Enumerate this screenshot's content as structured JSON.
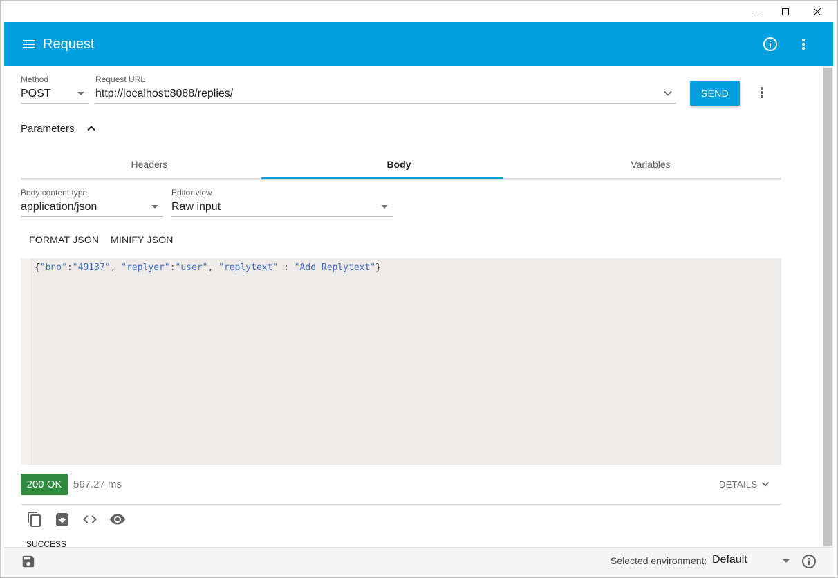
{
  "window": {
    "controls": {
      "minimize": "minimize-icon",
      "maximize": "maximize-icon",
      "close": "close-icon"
    }
  },
  "appbar": {
    "title": "Request",
    "color": "#03a0e0",
    "icons": {
      "menu": "menu-icon",
      "info": "info-icon",
      "more": "more-vert-icon"
    }
  },
  "request": {
    "method_label": "Method",
    "method_value": "POST",
    "url_label": "Request URL",
    "url_value": "http://localhost:8088/replies/",
    "send_label": "SEND"
  },
  "parameters": {
    "label": "Parameters",
    "tabs": [
      {
        "label": "Headers",
        "active": false
      },
      {
        "label": "Body",
        "active": true
      },
      {
        "label": "Variables",
        "active": false
      }
    ]
  },
  "body": {
    "content_type_label": "Body content type",
    "content_type_value": "application/json",
    "editor_view_label": "Editor view",
    "editor_view_value": "Raw input",
    "format_json_label": "FORMAT JSON",
    "minify_json_label": "MINIFY JSON",
    "code": {
      "open": "{",
      "k1": "\"bno\"",
      "c1": ":",
      "v1": "\"49137\"",
      "s1": ", ",
      "k2": "\"replyer\"",
      "c2": ":",
      "v2": "\"user\"",
      "s2": ", ",
      "k3": "\"replytext\"",
      "c3": " : ",
      "v3": "\"Add Replytext\"",
      "close": "}"
    }
  },
  "response": {
    "status": "200 OK",
    "status_color": "#2e8b3e",
    "time": "567.27 ms",
    "details_label": "DETAILS",
    "actions": [
      "copy-icon",
      "save-response-icon",
      "code-icon",
      "preview-icon"
    ],
    "text": "SUCCESS"
  },
  "footer": {
    "env_label": "Selected environment:",
    "env_value": "Default"
  }
}
